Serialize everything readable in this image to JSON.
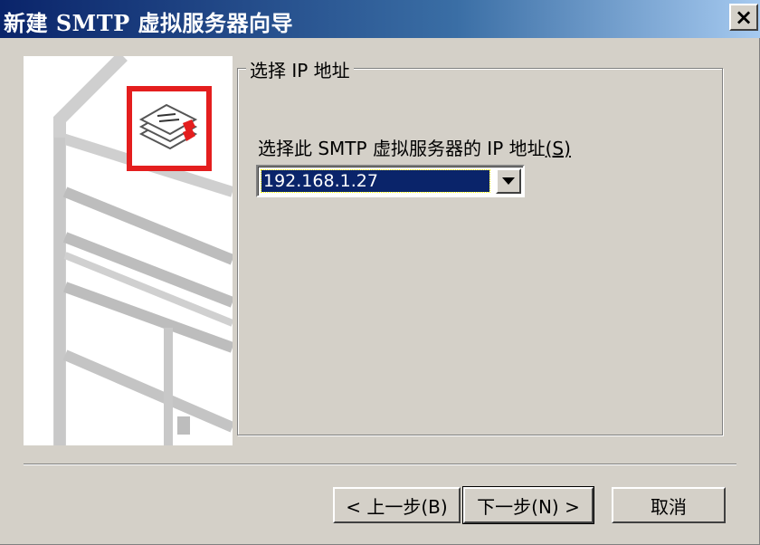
{
  "window": {
    "title": "新建 SMTP 虚拟服务器向导",
    "close_label": "×"
  },
  "group": {
    "legend": "选择 IP 地址",
    "field_label": "选择此 SMTP 虚拟服务器的 IP 地址",
    "field_mnemonic": "(S)",
    "ip_value": "192.168.1.27"
  },
  "buttons": {
    "back": "< 上一步(B)",
    "next": "下一步(N) >",
    "cancel": "取消"
  },
  "colors": {
    "titlebar": "#0a246a",
    "face": "#d4d0c8",
    "selection": "#0a246a",
    "accent_red": "#e41e1e"
  },
  "icons": [
    "close-icon",
    "dropdown-arrow-icon",
    "smtp-mail-icon"
  ]
}
